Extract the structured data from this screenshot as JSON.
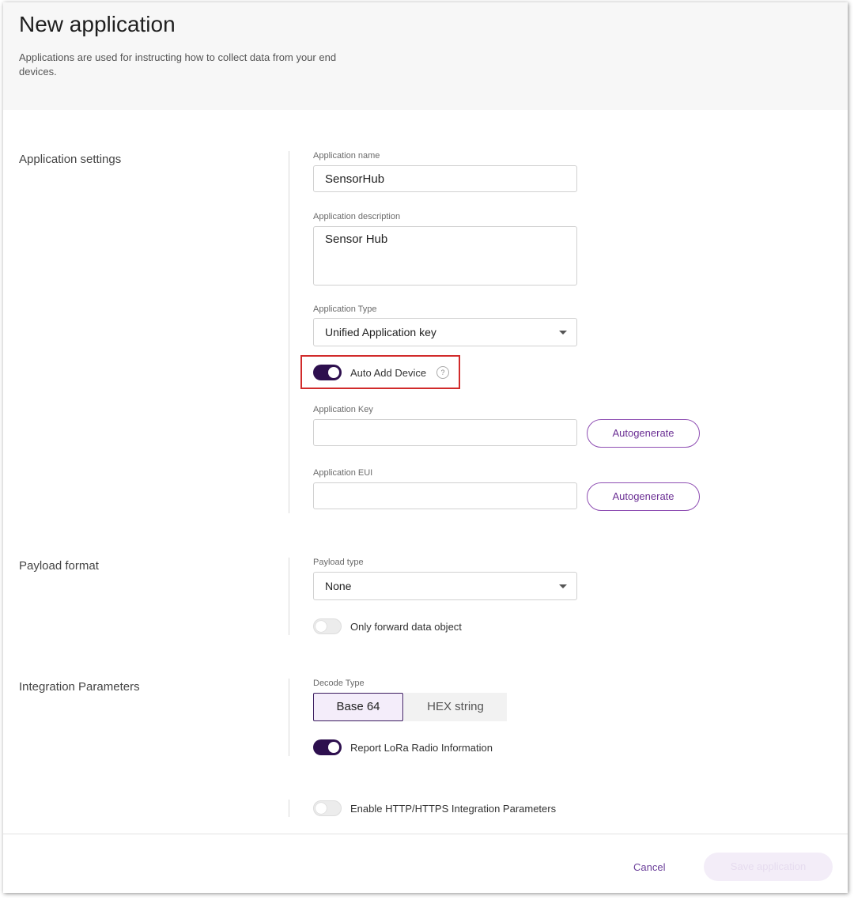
{
  "header": {
    "title": "New application",
    "description": "Applications are used for instructing how to collect data from your end devices."
  },
  "sections": {
    "application_settings": "Application settings",
    "payload_format": "Payload format",
    "integration_parameters": "Integration Parameters"
  },
  "app_settings": {
    "name_label": "Application name",
    "name_value": "SensorHub",
    "description_label": "Application description",
    "description_value": "Sensor Hub",
    "type_label": "Application Type",
    "type_value": "Unified Application key",
    "auto_add_label": "Auto Add Device",
    "auto_add_on": true,
    "help_glyph": "?",
    "key_label": "Application Key",
    "key_value": "",
    "eui_label": "Application EUI",
    "eui_value": "",
    "autogenerate_label": "Autogenerate"
  },
  "payload": {
    "type_label": "Payload type",
    "type_value": "None",
    "only_forward_label": "Only forward data object",
    "only_forward_on": false
  },
  "integration": {
    "decode_label": "Decode Type",
    "decode_options": [
      "Base 64",
      "HEX string"
    ],
    "decode_selected": "Base 64",
    "report_lora_label": "Report LoRa Radio Information",
    "report_lora_on": true,
    "http_label": "Enable HTTP/HTTPS Integration Parameters",
    "http_on": false
  },
  "footer": {
    "cancel_label": "Cancel",
    "save_label": "Save application"
  },
  "colors": {
    "accent": "#2d0f4e",
    "link": "#6b3f9a",
    "highlight_border": "#d12b2b"
  },
  "icons": {
    "help": "help-circle-icon",
    "dropdown": "chevron-down-icon"
  }
}
